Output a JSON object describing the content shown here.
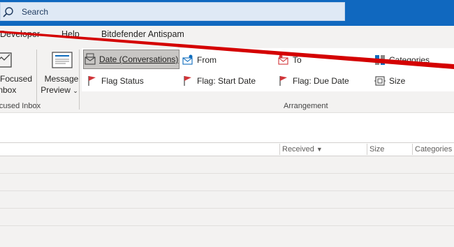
{
  "search": {
    "label": "Search"
  },
  "menu": {
    "items": [
      "Developer",
      "Help",
      "Bitdefender Antispam"
    ]
  },
  "ribbon": {
    "focused_inbox": {
      "line1": "Focused",
      "line2": "Inbox",
      "group_label": "Focused Inbox"
    },
    "message_preview": {
      "line1": "Message",
      "line2": "Preview",
      "chevron": "⌄"
    },
    "arrangement": {
      "group_label": "Arrangement",
      "options": [
        {
          "label": "Date (Conversations)",
          "icon": "date-conversations-icon",
          "selected": true
        },
        {
          "label": "From",
          "icon": "from-icon"
        },
        {
          "label": "To",
          "icon": "to-icon"
        },
        {
          "label": "Categories",
          "icon": "categories-icon"
        },
        {
          "label": "Flag Status",
          "icon": "flag-icon"
        },
        {
          "label": "Flag: Start Date",
          "icon": "flag-icon"
        },
        {
          "label": "Flag: Due Date",
          "icon": "flag-icon"
        },
        {
          "label": "Size",
          "icon": "size-icon"
        }
      ]
    }
  },
  "message_list": {
    "columns": [
      "Received",
      "Size",
      "Categories"
    ],
    "sort_column": "Received",
    "sort_direction": "descending"
  },
  "colors": {
    "titlebar": "#1068bf",
    "flag": "#d13438",
    "annotation": "#d40000"
  }
}
